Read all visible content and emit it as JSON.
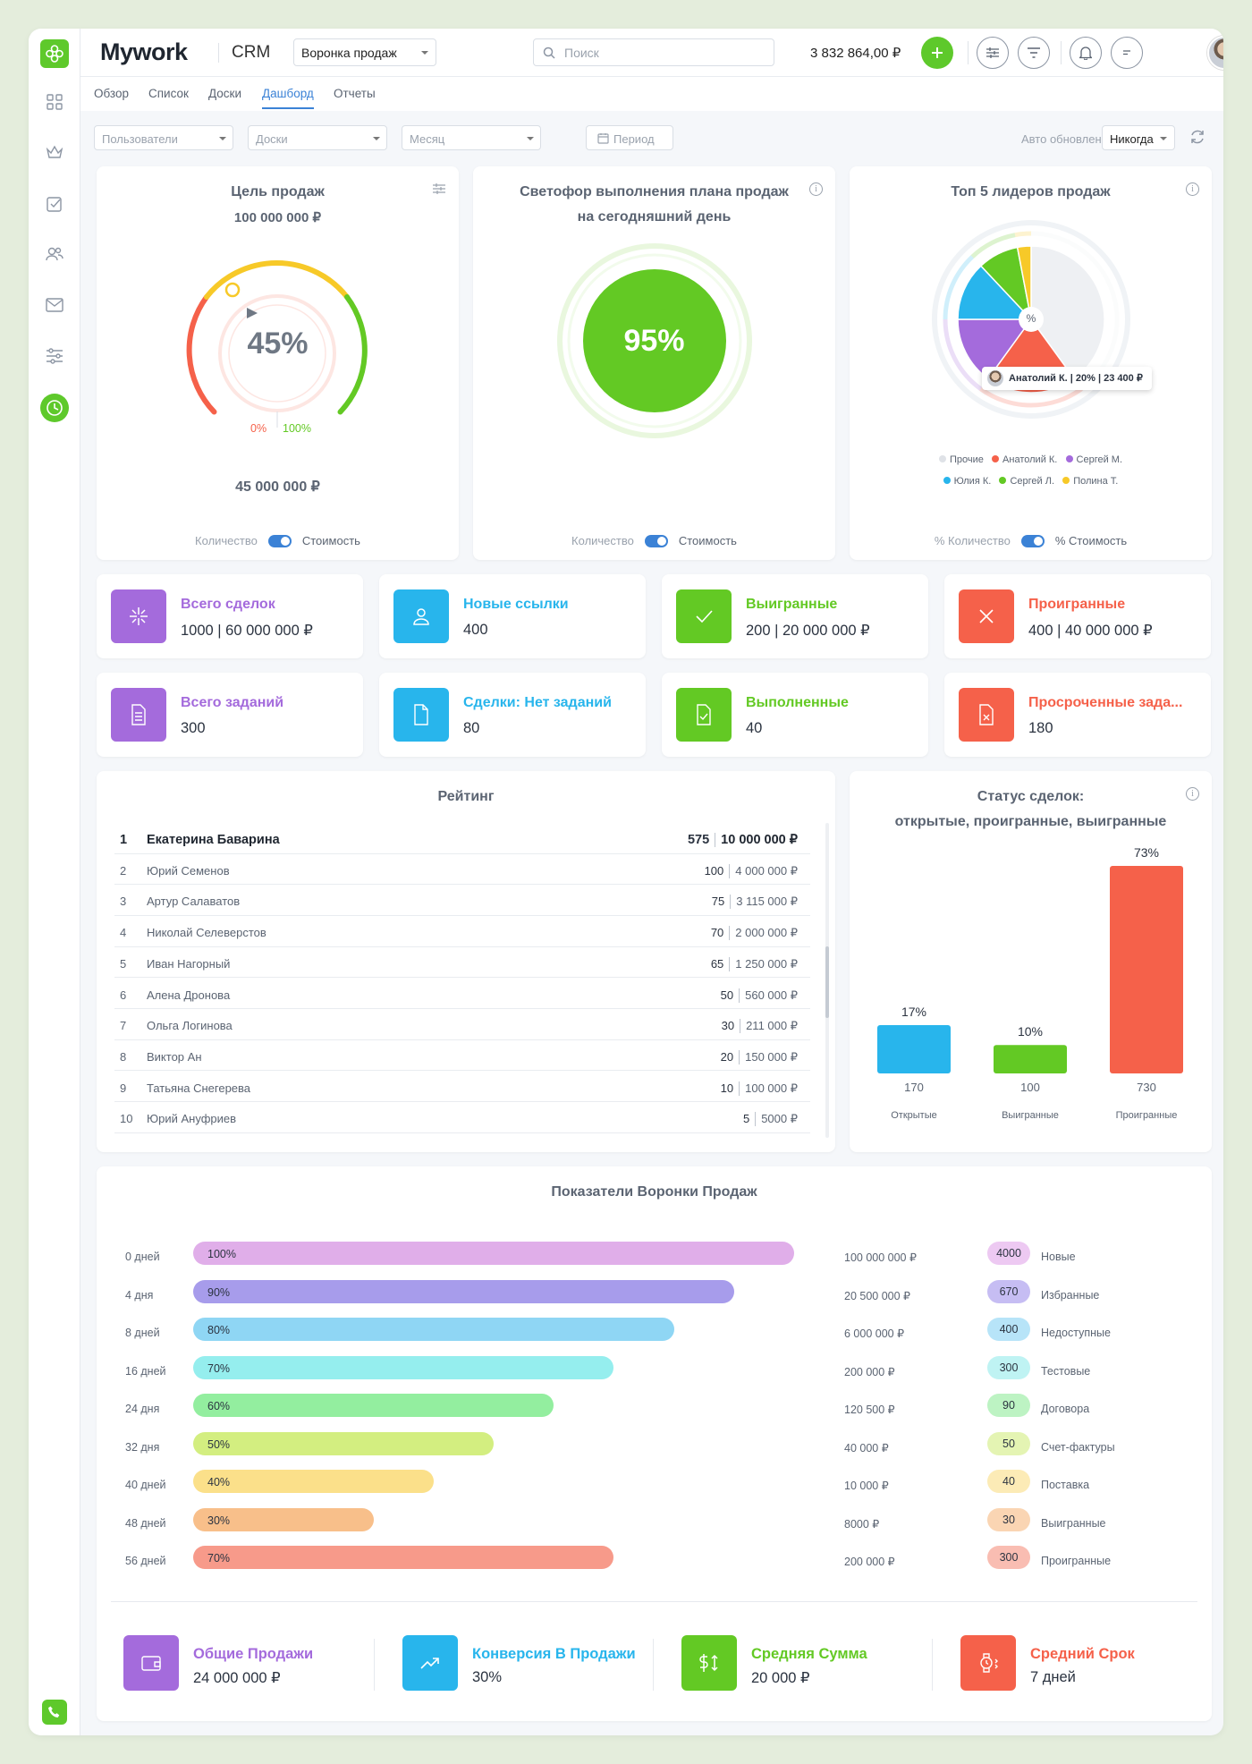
{
  "header": {
    "brand": "Mywork",
    "module": "CRM",
    "funnel_select": "Воронка продаж",
    "search_placeholder": "Поиск",
    "balance": "3 832 864,00 ₽"
  },
  "nav_tabs": [
    {
      "label": "Обзор",
      "active": false
    },
    {
      "label": "Список",
      "active": false
    },
    {
      "label": "Доски",
      "active": false
    },
    {
      "label": "Дашборд",
      "active": true
    },
    {
      "label": "Отчеты",
      "active": false
    }
  ],
  "filters": {
    "users": "Пользователи",
    "boards": "Доски",
    "month": "Месяц",
    "period": "Период",
    "auto_update_label": "Авто обновление",
    "auto_update_value": "Никогда"
  },
  "sales_goal": {
    "title": "Цель продаж",
    "target": "100 000 000 ₽",
    "percent": "45%",
    "progress": 0.45,
    "min_label": "0%",
    "max_label": "100%",
    "current": "45 000 000 ₽",
    "toggle_left": "Количество",
    "toggle_right": "Стоимость"
  },
  "traffic_light": {
    "title_line1": "Светофор выполнения плана продаж",
    "title_line2": "на сегодняшний день",
    "percent": "95%",
    "toggle_left": "Количество",
    "toggle_right": "Стоимость"
  },
  "top5": {
    "title": "Топ 5 лидеров продаж",
    "center_label": "%",
    "tooltip": "Анатолий К. | 20% | 23 400 ₽",
    "slices": [
      {
        "name": "Прочие",
        "value": 40,
        "color": "#eef0f3"
      },
      {
        "name": "Анатолий К.",
        "value": 20,
        "color": "#f5614a"
      },
      {
        "name": "Сергей М.",
        "value": 15,
        "color": "#a46bdc"
      },
      {
        "name": "Юлия К.",
        "value": 13,
        "color": "#28b5ec"
      },
      {
        "name": "Сергей Л.",
        "value": 9,
        "color": "#63c924"
      },
      {
        "name": "Полина Т.",
        "value": 3,
        "color": "#f7c928"
      }
    ],
    "legend": [
      "Прочие",
      "Анатолий К.",
      "Сергей М.",
      "Юлия К.",
      "Сергей Л.",
      "Полина Т."
    ],
    "toggle_left": "% Количество",
    "toggle_right": "% Стоимость"
  },
  "kpis": [
    {
      "label": "Всего сделок",
      "value": "1000 | 60 000 000 ₽",
      "color": "#a46bdc",
      "icon": "deals-icon"
    },
    {
      "label": "Новые ссылки",
      "value": "400",
      "color": "#28b5ec",
      "icon": "user-icon"
    },
    {
      "label": "Выигранные",
      "value": "200 | 20 000 000 ₽",
      "color": "#63c924",
      "icon": "check-icon"
    },
    {
      "label": "Проигранные",
      "value": "400 | 40 000 000 ₽",
      "color": "#f5614a",
      "icon": "cross-icon"
    },
    {
      "label": "Всего заданий",
      "value": "300",
      "color": "#a46bdc",
      "icon": "document-icon"
    },
    {
      "label": "Сделки: Нет заданий",
      "value": "80",
      "color": "#28b5ec",
      "icon": "blank-document-icon"
    },
    {
      "label": "Выполненные",
      "value": "40",
      "color": "#63c924",
      "icon": "document-check-icon"
    },
    {
      "label": "Просроченные зада...",
      "value": "180",
      "color": "#f5614a",
      "icon": "document-cross-icon"
    }
  ],
  "rating": {
    "title": "Рейтинг",
    "rows": [
      {
        "n": "1",
        "name": "Екатерина Баварина",
        "count": "575",
        "sum": "10 000 000 ₽"
      },
      {
        "n": "2",
        "name": "Юрий Семенов",
        "count": "100",
        "sum": "4 000 000 ₽"
      },
      {
        "n": "3",
        "name": "Артур Салаватов",
        "count": "75",
        "sum": "3 115 000 ₽"
      },
      {
        "n": "4",
        "name": "Николай Селеверстов",
        "count": "70",
        "sum": "2 000 000 ₽"
      },
      {
        "n": "5",
        "name": "Иван Нагорный",
        "count": "65",
        "sum": "1 250 000 ₽"
      },
      {
        "n": "6",
        "name": "Алена Дронова",
        "count": "50",
        "sum": "560 000 ₽"
      },
      {
        "n": "7",
        "name": "Ольга Логинова",
        "count": "30",
        "sum": "211 000 ₽"
      },
      {
        "n": "8",
        "name": "Виктор Ан",
        "count": "20",
        "sum": "150 000 ₽"
      },
      {
        "n": "9",
        "name": "Татьяна Снегерева",
        "count": "10",
        "sum": "100 000 ₽"
      },
      {
        "n": "10",
        "name": "Юрий Ануфриев",
        "count": "5",
        "sum": "5000 ₽"
      }
    ]
  },
  "deal_status": {
    "title_line1": "Статус сделок:",
    "title_line2": "открытые, проигранные, выигранные",
    "chart_data": {
      "type": "bar",
      "categories": [
        "Открытые",
        "Выигранные",
        "Проигранные"
      ],
      "values": [
        17,
        10,
        73
      ],
      "value_labels": [
        "17%",
        "10%",
        "73%"
      ],
      "counts": [
        "170",
        "100",
        "730"
      ],
      "colors": [
        "#28b5ec",
        "#63c924",
        "#f5614a"
      ],
      "ylim": [
        0,
        73
      ]
    }
  },
  "funnel": {
    "title": "Показатели Воронки Продаж",
    "rows": [
      {
        "days": "0 дней",
        "pct": "100%",
        "value": 100,
        "amount": "100 000 000 ₽",
        "count": "4000",
        "stage": "Новые",
        "color": "#e0aee9",
        "pill": "#edc9f2"
      },
      {
        "days": "4 дня",
        "pct": "90%",
        "value": 90,
        "amount": "20 500 000 ₽",
        "count": "670",
        "stage": "Избранные",
        "color": "#a79ceb",
        "pill": "#c6bdf3"
      },
      {
        "days": "8 дней",
        "pct": "80%",
        "value": 80,
        "amount": "6 000 000 ₽",
        "count": "400",
        "stage": "Недоступные",
        "color": "#8fd6f4",
        "pill": "#b7e4f8"
      },
      {
        "days": "16 дней",
        "pct": "70%",
        "value": 70,
        "amount": "200 000 ₽",
        "count": "300",
        "stage": "Тестовые",
        "color": "#95eeee",
        "pill": "#bff3f3"
      },
      {
        "days": "24 дня",
        "pct": "60%",
        "value": 60,
        "amount": "120 500 ₽",
        "count": "90",
        "stage": "Договора",
        "color": "#93ee9f",
        "pill": "#bdf3c3"
      },
      {
        "days": "32 дня",
        "pct": "50%",
        "value": 50,
        "amount": "40 000 ₽",
        "count": "50",
        "stage": "Счет-фактуры",
        "color": "#d3ee80",
        "pill": "#e4f4b3"
      },
      {
        "days": "40 дней",
        "pct": "40%",
        "value": 40,
        "amount": "10 000 ₽",
        "count": "40",
        "stage": "Поставка",
        "color": "#fbe08a",
        "pill": "#fcebb6"
      },
      {
        "days": "48 дней",
        "pct": "30%",
        "value": 30,
        "amount": "8000 ₽",
        "count": "30",
        "stage": "Выигранные",
        "color": "#f8bf8a",
        "pill": "#fad5b3"
      },
      {
        "days": "56 дней",
        "pct": "70%",
        "value": 70,
        "amount": "200 000 ₽",
        "count": "300",
        "stage": "Проигранные",
        "color": "#f79a8a",
        "pill": "#f9bdb2"
      }
    ]
  },
  "summary": [
    {
      "label": "Общие Продажи",
      "value": "24 000 000 ₽",
      "color": "#a46bdc",
      "icon": "wallet-icon"
    },
    {
      "label": "Конверсия В Продажи",
      "value": "30%",
      "color": "#28b5ec",
      "icon": "trend-up-icon"
    },
    {
      "label": "Средняя Сумма",
      "value": "20 000 ₽",
      "color": "#63c924",
      "icon": "dollar-arrows-icon"
    },
    {
      "label": "Средний Срок",
      "value": "7 дней",
      "color": "#f5614a",
      "icon": "watch-icon"
    }
  ]
}
